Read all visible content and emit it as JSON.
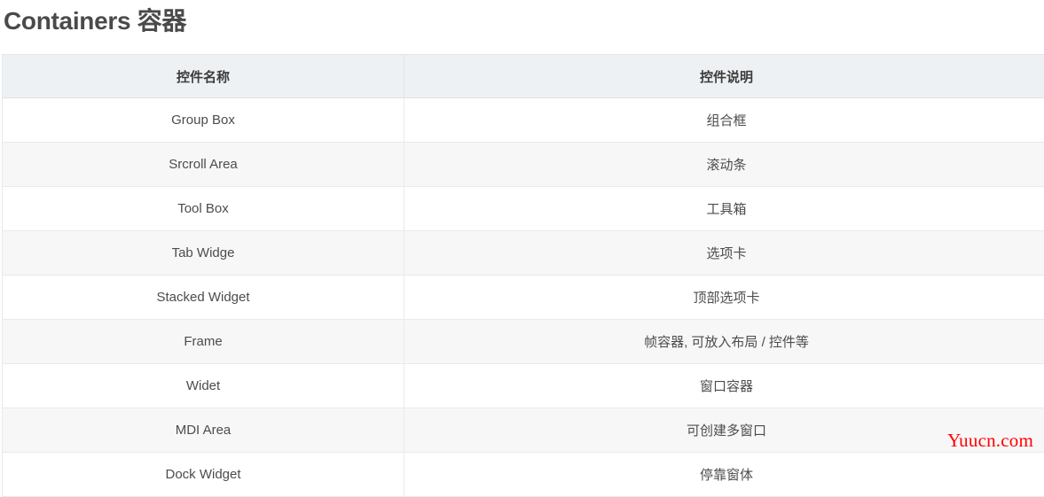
{
  "page": {
    "title": "Containers 容器"
  },
  "table": {
    "headers": [
      "控件名称",
      "控件说明"
    ],
    "rows": [
      {
        "name": "Group Box",
        "desc": "组合框"
      },
      {
        "name": "Srcroll Area",
        "desc": "滚动条"
      },
      {
        "name": "Tool Box",
        "desc": "工具箱"
      },
      {
        "name": "Tab Widge",
        "desc": "选项卡"
      },
      {
        "name": "Stacked Widget",
        "desc": "顶部选项卡"
      },
      {
        "name": "Frame",
        "desc": "帧容器, 可放入布局 / 控件等"
      },
      {
        "name": "Widet",
        "desc": "窗口容器"
      },
      {
        "name": "MDI Area",
        "desc": "可创建多窗口"
      },
      {
        "name": "Dock Widget",
        "desc": "停靠窗体"
      }
    ]
  },
  "watermark": {
    "text": "Yuucn.com",
    "color": "#ff0000"
  },
  "colors": {
    "header_background": "#eef1f4",
    "row_odd": "#ffffff",
    "row_even": "#f7f7f7",
    "border": "#e8eaec",
    "text": "#4c4c4c",
    "title_text": "#4a4a4a"
  }
}
